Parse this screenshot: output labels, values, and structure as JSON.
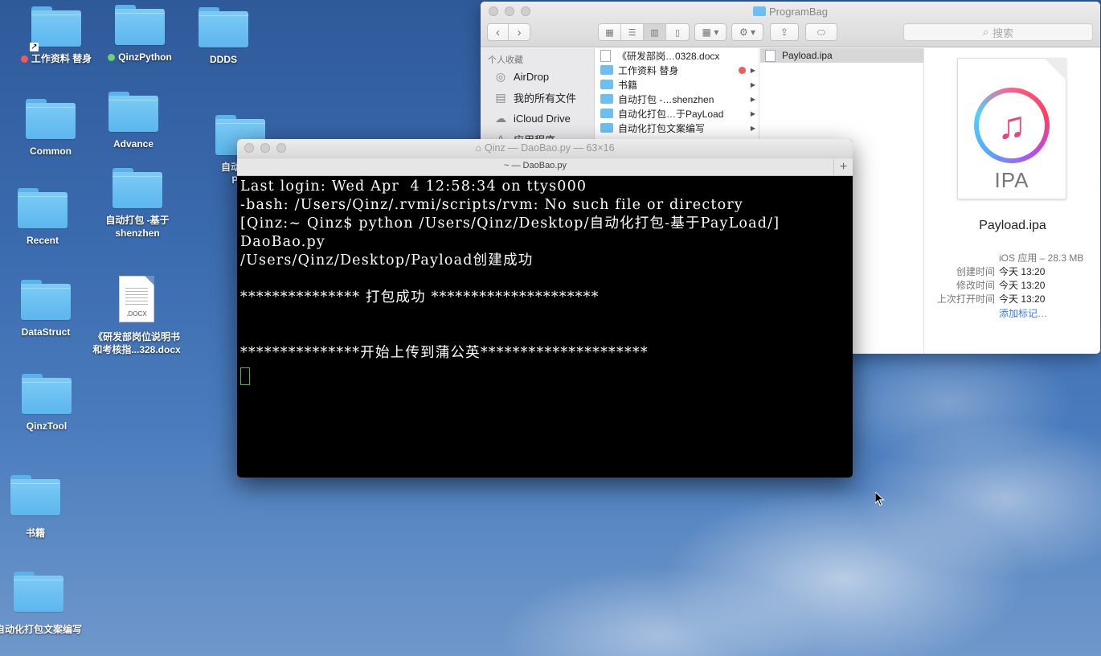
{
  "desktop": {
    "icons": [
      {
        "label": "工作资料 替身",
        "tag_color": "#f25a56"
      },
      {
        "label": "QinzPython",
        "tag_color": "#6dd36a"
      },
      {
        "label": "DDDS"
      },
      {
        "label": "Common"
      },
      {
        "label": "Advance"
      },
      {
        "label": "自动化打",
        "label2": "Pay"
      },
      {
        "label": "Recent"
      },
      {
        "label": "自动打包 -基于",
        "label2": "shenzhen"
      },
      {
        "label": "DataStruct"
      },
      {
        "label": "《研发部岗位说明书",
        "label2": "和考核指...328.docx",
        "ext": ".DOCX"
      },
      {
        "label": "QinzTool"
      },
      {
        "label": "书籍"
      },
      {
        "label": "自动化打包文案编写"
      }
    ]
  },
  "finder": {
    "title": "ProgramBag",
    "search_placeholder": "搜索",
    "sidebar": {
      "section": "个人收藏",
      "items": [
        {
          "label": "AirDrop",
          "icon": "airdrop-icon"
        },
        {
          "label": "我的所有文件",
          "icon": "all-files-icon"
        },
        {
          "label": "iCloud Drive",
          "icon": "cloud-icon"
        },
        {
          "label": "应用程序",
          "icon": "apps-icon"
        }
      ]
    },
    "column1": [
      {
        "label": "《研发部岗…0328.docx",
        "kind": "doc"
      },
      {
        "label": "工作资料 替身",
        "kind": "folder",
        "tag": true
      },
      {
        "label": "书籍",
        "kind": "folder"
      },
      {
        "label": "自动打包 -…shenzhen",
        "kind": "folder"
      },
      {
        "label": "自动化打包…于PayLoad",
        "kind": "folder"
      },
      {
        "label": "自动化打包文案编写",
        "kind": "folder"
      }
    ],
    "column2": [
      {
        "label": "Payload.ipa"
      }
    ],
    "preview": {
      "icon_text": "IPA",
      "name": "Payload.ipa",
      "kind": "iOS 应用 – 28.3 MB",
      "created_label": "创建时间",
      "created_value": "今天 13:20",
      "modified_label": "修改时间",
      "modified_value": "今天 13:20",
      "opened_label": "上次打开时间",
      "opened_value": "今天 13:20",
      "add_tags": "添加标记…"
    }
  },
  "terminal": {
    "title": "Qinz — DaoBao.py — 63×16",
    "tab": "~ — DaoBao.py",
    "lines": [
      "Last login: Wed Apr  4 12:58:34 on ttys000",
      "-bash: /Users/Qinz/.rvmi/scripts/rvm: No such file or directory",
      "[Qinz:~ Qinz$ python /Users/Qinz/Desktop/自动化打包-基于PayLoad/]",
      "DaoBao.py",
      "/Users/Qinz/Desktop/Payload创建成功",
      "",
      "*************** 打包成功 *********************",
      "",
      "",
      "***************开始上传到蒲公英*********************"
    ]
  }
}
